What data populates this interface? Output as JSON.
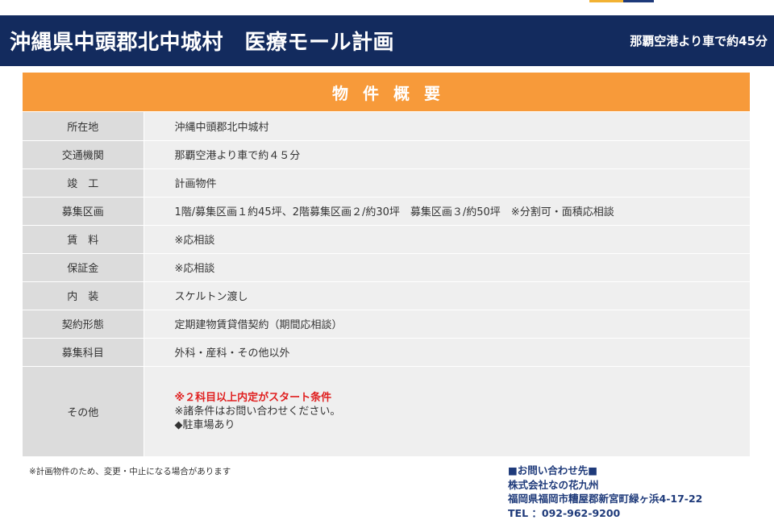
{
  "colors": {
    "header_bg": "#132b5e",
    "section_bg": "#f79a3a",
    "row_a": "#dcdcdc",
    "row_b": "#efefef",
    "accent_1": "#f2b233",
    "accent_2": "#1e3a7a",
    "contact_text": "#1e3a7a",
    "warning": "#e02020"
  },
  "header": {
    "title": "沖縄県中頭郡北中城村　医療モール計画",
    "access": "那覇空港より車で約45分"
  },
  "section": {
    "title": "物件概要"
  },
  "table": {
    "rows": [
      {
        "label": "所在地",
        "value": "沖縄中頭郡北中城村"
      },
      {
        "label": "交通機関",
        "value": "那覇空港より車で約４５分"
      },
      {
        "label": "竣　工",
        "value": "計画物件"
      },
      {
        "label": "募集区画",
        "value": "1階/募集区画１約45坪、2階募集区画２/約30坪　募集区画３/約50坪　※分割可・面積応相談"
      },
      {
        "label": "賃　料",
        "value": "※応相談"
      },
      {
        "label": "保証金",
        "value": "※応相談"
      },
      {
        "label": "内　装",
        "value": "スケルトン渡し"
      },
      {
        "label": "契約形態",
        "value": "定期建物賃貸借契約（期間応相談）"
      },
      {
        "label": "募集科目",
        "value": "外科・産科・その他以外"
      }
    ],
    "other": {
      "label": "その他",
      "warning": "※２科目以上内定がスタート条件",
      "line2": "※諸条件はお問い合わせください。",
      "line3": "◆駐車場あり"
    }
  },
  "note": "※計画物件のため、変更・中止になる場合があります",
  "contact": {
    "heading": "■お問い合わせ先■",
    "company": "株式会社なの花九州",
    "address": "福岡県福岡市糟屋郡新宮町緑ヶ浜4-17-22",
    "tel": "TEL ：092-962-9200"
  }
}
